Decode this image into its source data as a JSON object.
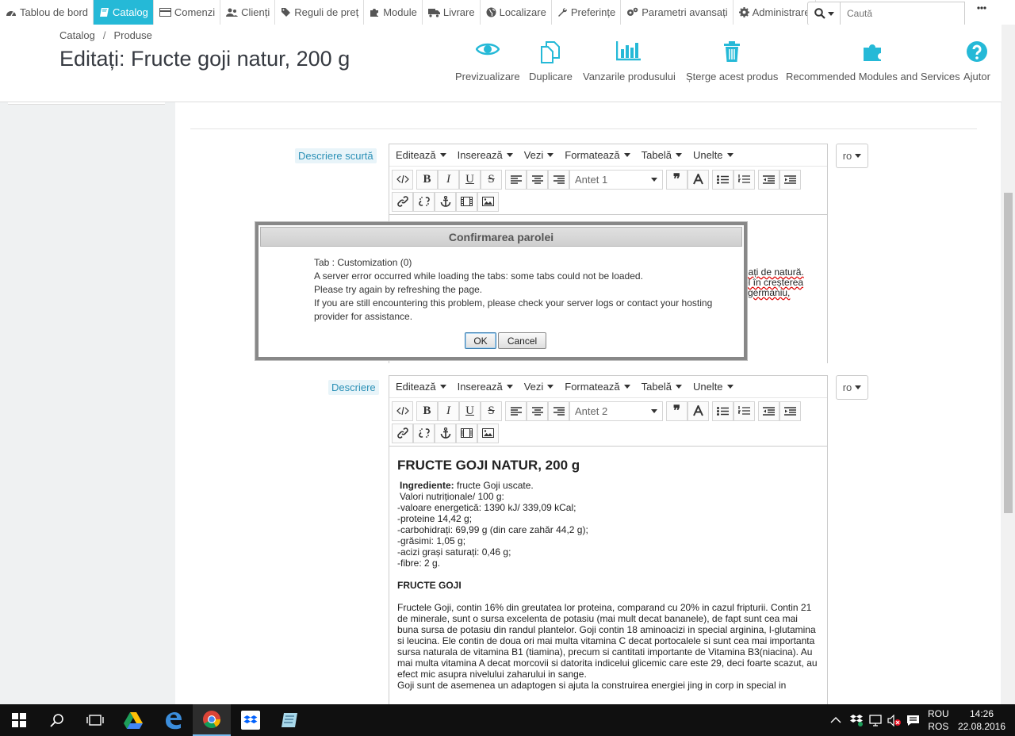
{
  "nav": {
    "items": [
      {
        "label": "Tablou de bord",
        "icon": "dashboard-icon"
      },
      {
        "label": "Catalog",
        "icon": "book-icon",
        "active": true
      },
      {
        "label": "Comenzi",
        "icon": "credit-card-icon"
      },
      {
        "label": "Clienți",
        "icon": "users-icon"
      },
      {
        "label": "Reguli de preț",
        "icon": "tag-icon"
      },
      {
        "label": "Module",
        "icon": "puzzle-icon"
      },
      {
        "label": "Livrare",
        "icon": "truck-icon"
      },
      {
        "label": "Localizare",
        "icon": "globe-icon"
      },
      {
        "label": "Preferințe",
        "icon": "wrench-icon"
      },
      {
        "label": "Parametri avansați",
        "icon": "cogs-icon"
      },
      {
        "label": "Administrare",
        "icon": "gear-icon"
      }
    ],
    "search_placeholder": "Caută",
    "accent_color": "#25b9d7"
  },
  "header": {
    "breadcrumb": [
      "Catalog",
      "Produse"
    ],
    "title": "Editați: Fructe goji natur, 200 g",
    "toolbar": {
      "preview": "Previzualizare",
      "duplicate": "Duplicare",
      "sales": "Vanzarile produsului",
      "delete": "Șterge acest produs",
      "recommended": "Recommended Modules and Services",
      "help": "Ajutor"
    }
  },
  "form": {
    "short_description_label": "Descriere scurtă",
    "description_label": "Descriere",
    "language": "ro",
    "editor_menus": [
      "Editează",
      "Inserează",
      "Vezi",
      "Formatează",
      "Tabelă",
      "Unelte"
    ],
    "short_heading_select": "Antet 1",
    "desc_heading_select": "Antet 2",
    "short_partial_lines": [
      "eați de natură.",
      "ol în creșterea",
      "i germaniu,"
    ],
    "description": {
      "heading": "FRUCTE GOJI NATUR, 200 g",
      "ingredients_label": "Ingrediente:",
      "ingredients_value": "fructe Goji uscate.",
      "nutrition_title": "Valori nutriționale/ 100 g:",
      "nutrition": [
        "-valoare energetică: 1390 kJ/ 339,09 kCal;",
        "-proteine 14,42 g;",
        "-carbohidrați: 69,99 g (din care zahăr 44,2 g);",
        "-grăsimi: 1,05 g;",
        "-acizi grași saturați: 0,46 g;",
        "-fibre: 2 g."
      ],
      "subheading": "FRUCTE GOJI",
      "paragraph": "Fructele Goji, contin 16% din greutatea lor proteina, comparand cu 20% in cazul fripturii. Contin 21 de minerale, sunt o sursa excelenta de potasiu (mai mult decat bananele), de fapt sunt cea mai buna sursa de potasiu din randul plantelor.  Goji contin 18 aminoacizi in special arginina, l-glutamina si leucina.  Ele contin de doua ori mai multa vitamina C decat portocalele si sunt cea mai importanta sursa naturala de vitamina B1 (tiamina), precum si cantitati importante de Vitamina B3(niacina). Au mai multa vitamina A decat morcovii si datorita indicelui glicemic care este 29, deci foarte scazut, au efect mic asupra nivelului zaharului in sange.",
      "paragraph2": "Goji sunt de asemenea un adaptogen si ajuta la construirea energiei jing in corp in special in"
    }
  },
  "dialog": {
    "title": "Confirmarea parolei",
    "lines": [
      "Tab : Customization (0)",
      "A server error occurred while loading the tabs: some tabs could not be loaded.",
      "Please try again by refreshing the page.",
      "If you are still encountering this problem, please check your server logs or contact your hosting provider for assistance."
    ],
    "ok": "OK",
    "cancel": "Cancel"
  },
  "taskbar": {
    "language_top": "ROU",
    "language_bottom": "ROS",
    "time": "14:26",
    "date": "22.08.2016"
  }
}
